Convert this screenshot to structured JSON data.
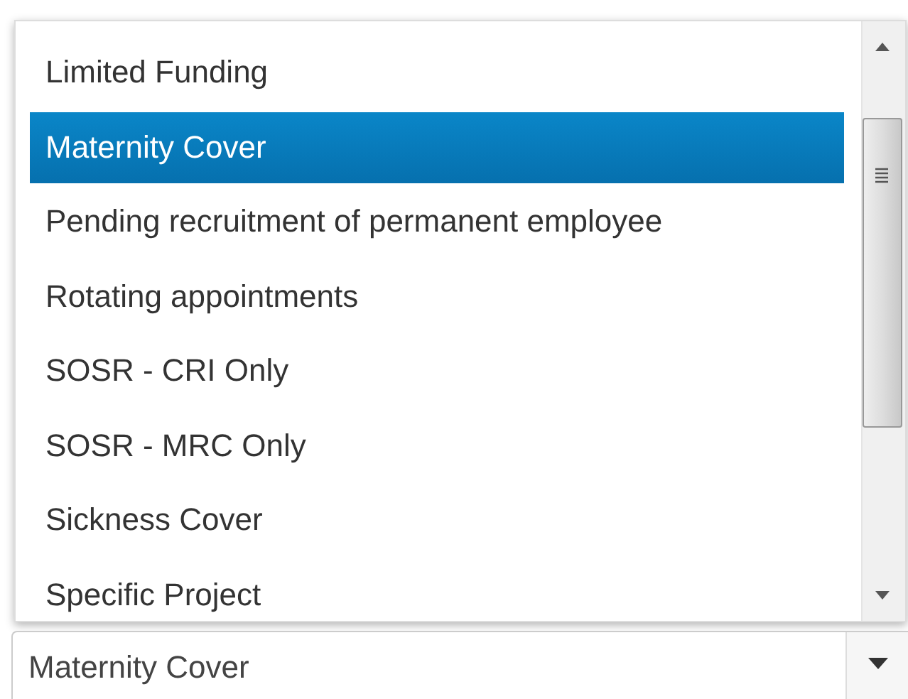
{
  "dropdown": {
    "options": [
      {
        "label": "Limited Funding",
        "selected": false
      },
      {
        "label": "Maternity Cover",
        "selected": true
      },
      {
        "label": "Pending recruitment of permanent employee",
        "selected": false
      },
      {
        "label": "Rotating appointments",
        "selected": false
      },
      {
        "label": "SOSR - CRI Only",
        "selected": false
      },
      {
        "label": "SOSR - MRC Only",
        "selected": false
      },
      {
        "label": "Sickness Cover",
        "selected": false
      },
      {
        "label": "Specific Project",
        "selected": false
      }
    ]
  },
  "select": {
    "value": "Maternity Cover"
  }
}
